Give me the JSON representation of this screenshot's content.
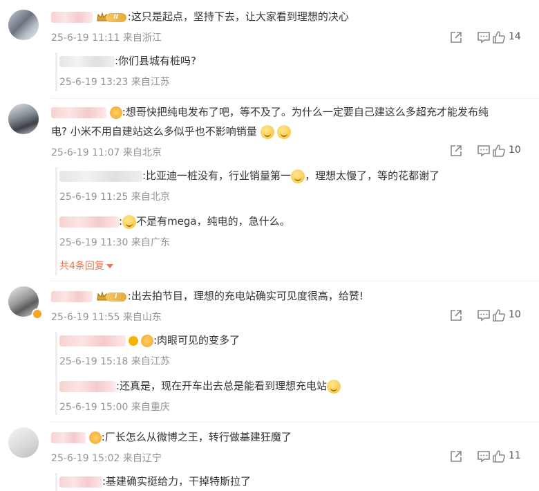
{
  "comments": [
    {
      "text": ":这只是起点，坚持下去，让大家看到理想的决心",
      "meta": "25-6-19 11:11 来自浙江",
      "likes": "14",
      "replies": [
        {
          "text": ":你们县城有桩吗?",
          "meta": "25-6-19 13:23 来自江苏"
        }
      ]
    },
    {
      "text": ":想哥快把纯电发布了吧，等不及了。为什么一定要自己建这么多超充才能发布纯",
      "text2": "电? 小米不用自建站这么多似乎也不影响销量",
      "meta": "25-6-19 11:07 来自北京",
      "likes": "10",
      "replies": [
        {
          "text_a": ":比亚迪一桩没有，行业销量第一",
          "text_b": "，理想太慢了，等的花都谢了",
          "meta": "25-6-19 11:25 来自北京"
        },
        {
          "text": "不是有mega，纯电的，急什么。",
          "meta": "25-6-19 11:30 来自广东"
        }
      ],
      "more": "共4条回复"
    },
    {
      "text": ":出去拍节目，理想的充电站确实可见度很高，给赞!",
      "meta": "25-6-19 11:55 来自山东",
      "likes": "10",
      "replies": [
        {
          "text": ":肉眼可见的变多了",
          "meta": "25-6-19 15:18 来自江苏"
        },
        {
          "text": ":还真是，现在开车出去总是能看到理想充电站",
          "meta": "25-6-19 15:00 来自重庆"
        }
      ]
    },
    {
      "text": ":厂长怎么从微博之王，转行做基建狂魔了",
      "meta": "25-6-19 15:02 来自辽宁",
      "likes": "11",
      "replies": [
        {
          "text": ":基建确实挺给力，干掉特斯拉了"
        }
      ]
    }
  ],
  "badges": {
    "c1": "II",
    "c3": "I"
  },
  "colors": {
    "accent": "#eb7350",
    "meta": "#939393",
    "text": "#333333"
  },
  "icons": [
    "share-icon",
    "comment-icon",
    "like-icon"
  ]
}
